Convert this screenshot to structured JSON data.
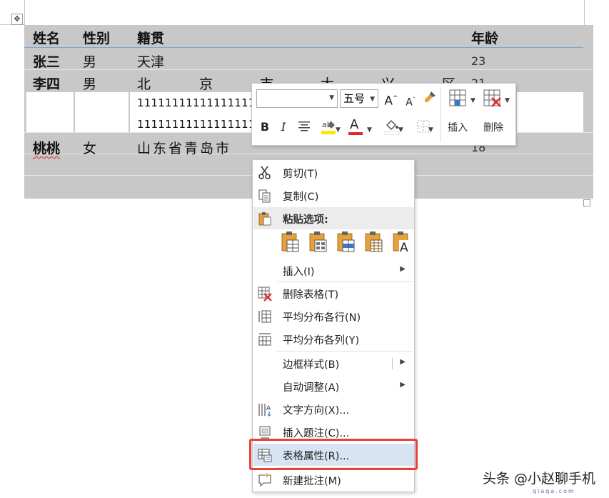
{
  "table": {
    "header": {
      "name": "姓名",
      "gender": "性别",
      "origin": "籍贯",
      "age": "年龄"
    },
    "rows": [
      {
        "name": "张三",
        "gender": "男",
        "origin": "天津",
        "age": "23"
      },
      {
        "name": "李四",
        "gender": "男",
        "origin_chars": [
          "北",
          "京",
          "市",
          "大",
          "兴",
          "区"
        ],
        "age": "21",
        "digits_1": "11111111111111111",
        "digits_2": "11111111111111111"
      },
      {
        "name": "桃桃",
        "gender": "女",
        "origin": "山东省青岛市",
        "age": "18"
      }
    ]
  },
  "mini_toolbar": {
    "font_name": "",
    "font_size": "五号",
    "grow_font": "A",
    "shrink_font": "A",
    "bold": "B",
    "italic": "I",
    "font_color_letter": "A",
    "insert_label": "插入",
    "delete_label": "删除"
  },
  "context_menu": {
    "items": [
      {
        "label": "剪切(T)",
        "icon": "scissors-icon"
      },
      {
        "label": "复制(C)",
        "icon": "copy-icon"
      },
      {
        "label": "粘贴选项:",
        "icon": "paste-icon"
      },
      {
        "label": "插入(I)",
        "icon": "",
        "submenu": true
      },
      {
        "label": "删除表格(T)",
        "icon": "delete-table-icon"
      },
      {
        "label": "平均分布各行(N)",
        "icon": "distribute-rows-icon"
      },
      {
        "label": "平均分布各列(Y)",
        "icon": "distribute-columns-icon"
      },
      {
        "label": "边框样式(B)",
        "icon": "",
        "submenu": true
      },
      {
        "label": "自动调整(A)",
        "icon": "",
        "submenu": true
      },
      {
        "label": "文字方向(X)...",
        "icon": "text-direction-icon"
      },
      {
        "label": "插入题注(C)...",
        "icon": "insert-caption-icon"
      },
      {
        "label": "表格属性(R)...",
        "icon": "table-properties-icon"
      },
      {
        "label": "新建批注(M)",
        "icon": "new-comment-icon"
      }
    ],
    "paste_options": [
      "paste-keep-source-icon",
      "paste-merge-format-icon",
      "paste-nested-table-icon",
      "paste-insert-rows-icon",
      "paste-text-only-icon"
    ]
  },
  "colors": {
    "table_shade": "#c8c8c8",
    "menu_highlight": "#d8e4f2",
    "frame_red": "#e8423a",
    "highlighter_yellow": "#ffe600",
    "font_red": "#e0262a"
  },
  "watermark": {
    "text": "头条 @小赵聊手机",
    "url": "qiaqa.com"
  }
}
